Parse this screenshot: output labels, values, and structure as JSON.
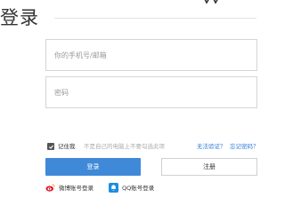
{
  "header": {
    "title": "登录"
  },
  "form": {
    "phone_placeholder": "你的手机号/邮箱",
    "password_placeholder": "密码",
    "remember_label": "记住我",
    "remember_hint": "不是自己的电脑上不要勾选此项",
    "remember_checked": true,
    "verify_link": "无法验证？",
    "forgot_link": "忘记密码？",
    "login_button": "登录",
    "register_button": "注册"
  },
  "social": {
    "weibo_label": "微博账号登录",
    "qq_label": "QQ账号登录"
  },
  "colors": {
    "primary": "#3f89d8",
    "link": "#2e7bd6",
    "weibo": "#e6162d",
    "qq": "#1a8ee1"
  },
  "icons": {
    "checkbox": "check-icon",
    "weibo": "weibo-icon",
    "qq": "qq-icon",
    "corner": "decorative-icon"
  }
}
